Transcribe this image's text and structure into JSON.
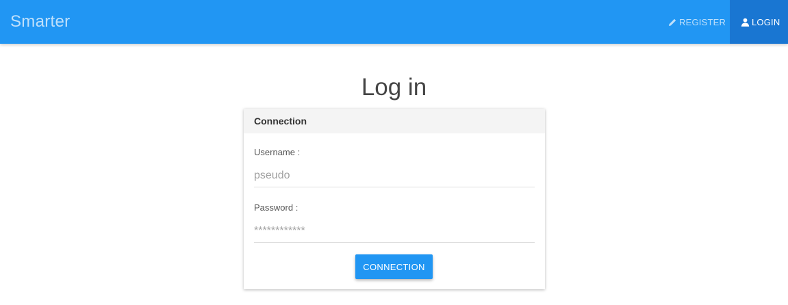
{
  "navbar": {
    "brand": "Smarter",
    "register": {
      "label": "REGISTER",
      "icon": "pencil-icon"
    },
    "login": {
      "label": "LOGIN",
      "icon": "user-icon",
      "active": true
    },
    "colors": {
      "bar": "#2196f3",
      "active": "#1976d2"
    }
  },
  "page": {
    "title": "Log in"
  },
  "form": {
    "header": "Connection",
    "username": {
      "label": "Username :",
      "placeholder": "pseudo",
      "value": ""
    },
    "password": {
      "label": "Password :",
      "placeholder": "************",
      "value": ""
    },
    "submit_label": "CONNECTION"
  }
}
